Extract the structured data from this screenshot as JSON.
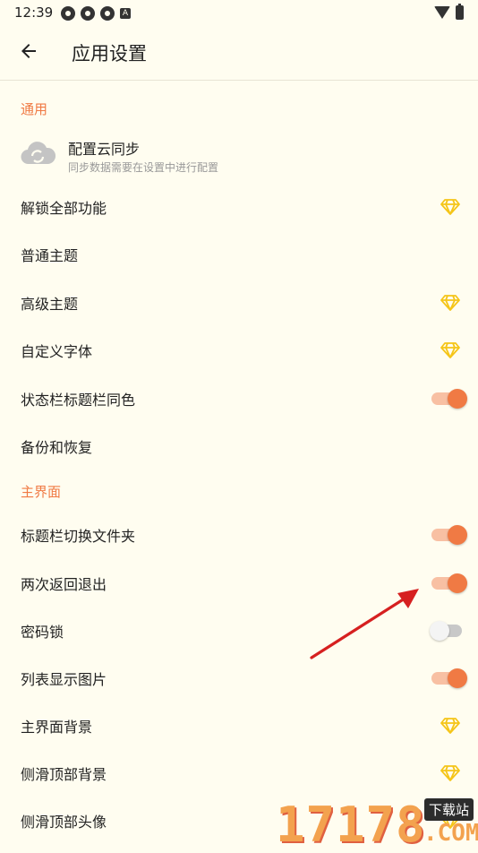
{
  "status_bar": {
    "time": "12:39",
    "notif_letter": "A"
  },
  "app_bar": {
    "title": "应用设置"
  },
  "general": {
    "section_title": "通用",
    "cloud_sync": {
      "title": "配置云同步",
      "subtitle": "同步数据需要在设置中进行配置"
    },
    "unlock_all": "解锁全部功能",
    "normal_theme": "普通主题",
    "advanced_theme": "高级主题",
    "custom_font": "自定义字体",
    "statusbar_same_color": {
      "label": "状态栏标题栏同色",
      "on": true
    },
    "backup_restore": "备份和恢复"
  },
  "main_ui": {
    "section_title": "主界面",
    "title_switch_folder": {
      "label": "标题栏切换文件夹",
      "on": true
    },
    "double_back_exit": {
      "label": "两次返回退出",
      "on": true
    },
    "password_lock": {
      "label": "密码锁",
      "on": false
    },
    "list_show_images": {
      "label": "列表显示图片",
      "on": true
    },
    "main_background": "主界面背景",
    "drawer_top_background": "侧滑顶部背景",
    "drawer_top_avatar": "侧滑顶部头像"
  },
  "watermark": {
    "number": "17178",
    "badge": "下载站",
    "domain": ".COM"
  },
  "colors": {
    "accent": "#f07a44",
    "gem": "#f5c518",
    "background": "#fffdf0"
  }
}
